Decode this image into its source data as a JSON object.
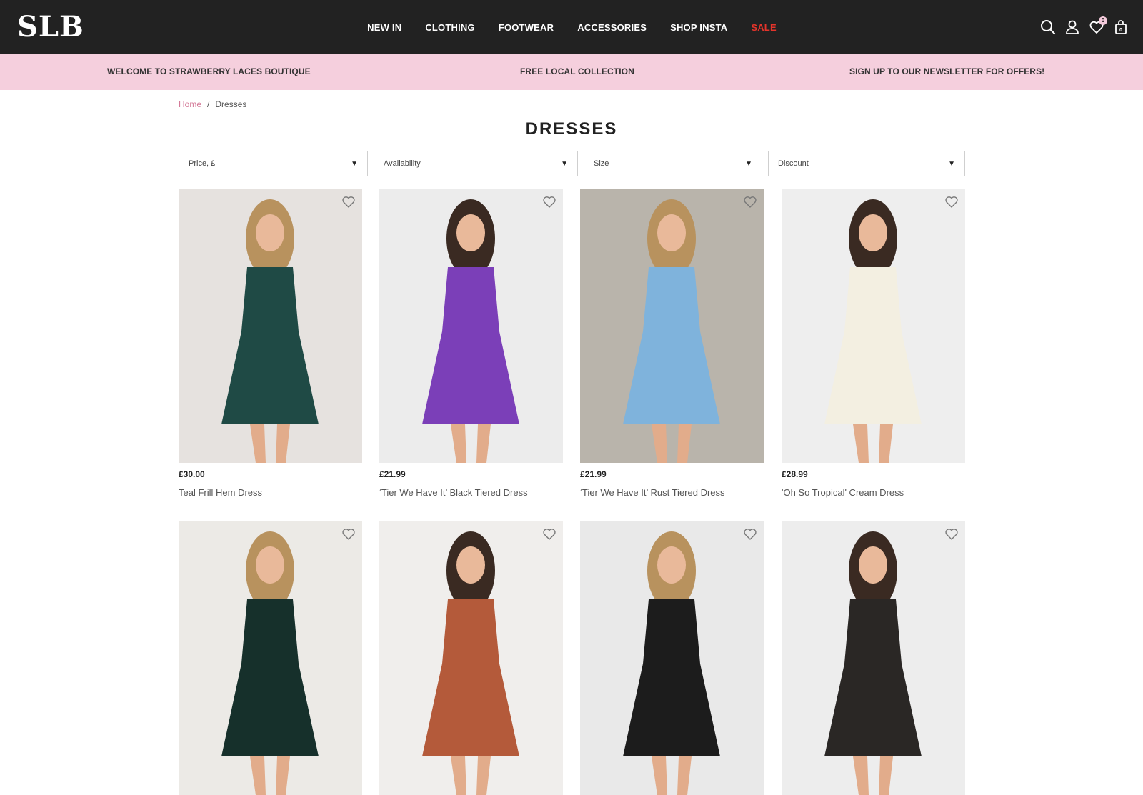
{
  "header": {
    "logo": "SLB",
    "nav": [
      {
        "label": "NEW IN"
      },
      {
        "label": "CLOTHING"
      },
      {
        "label": "FOOTWEAR"
      },
      {
        "label": "ACCESSORIES"
      },
      {
        "label": "SHOP INSTA"
      },
      {
        "label": "SALE"
      }
    ],
    "icons": [
      "search-icon",
      "account-icon",
      "wishlist-icon",
      "bag-icon"
    ],
    "wishlist_count": "0",
    "bag_count": "0",
    "sale_color": "#e5342b"
  },
  "promo": {
    "left": "WELCOME TO STRAWBERRY LACES BOUTIQUE",
    "center": "FREE LOCAL COLLECTION",
    "right": "SIGN UP TO OUR NEWSLETTER FOR OFFERS!",
    "background": "#f5cfdd"
  },
  "breadcrumb": {
    "home": "Home",
    "separator": "/",
    "current": "Dresses"
  },
  "page_title": "DRESSES",
  "filters": [
    {
      "label": "Price, £"
    },
    {
      "label": "Availability"
    },
    {
      "label": "Size"
    },
    {
      "label": "Discount"
    }
  ],
  "products": [
    {
      "price": "£30.00",
      "name": "Teal Frill Hem Dress",
      "dress_color": "#1f4a45",
      "bg": "#e6e2df"
    },
    {
      "price": "£21.99",
      "name": "‘Tier We Have It’ Black Tiered Dress",
      "dress_color": "#7b3fb8",
      "bg": "#ececec"
    },
    {
      "price": "£21.99",
      "name": "‘Tier We Have It’ Rust Tiered Dress",
      "dress_color": "#7fb3dc",
      "bg": "#b9b4ab"
    },
    {
      "price": "£28.99",
      "name": "'Oh So Tropical' Cream Dress",
      "dress_color": "#f3efe1",
      "bg": "#eeeeee"
    },
    {
      "price": "",
      "name": "",
      "dress_color": "#16302b",
      "bg": "#eceae6"
    },
    {
      "price": "",
      "name": "",
      "dress_color": "#b45a3a",
      "bg": "#f0eeec"
    },
    {
      "price": "",
      "name": "",
      "dress_color": "#1c1c1c",
      "bg": "#e9e9e9"
    },
    {
      "price": "",
      "name": "",
      "dress_color": "#2a2725",
      "bg": "#ededed"
    }
  ]
}
